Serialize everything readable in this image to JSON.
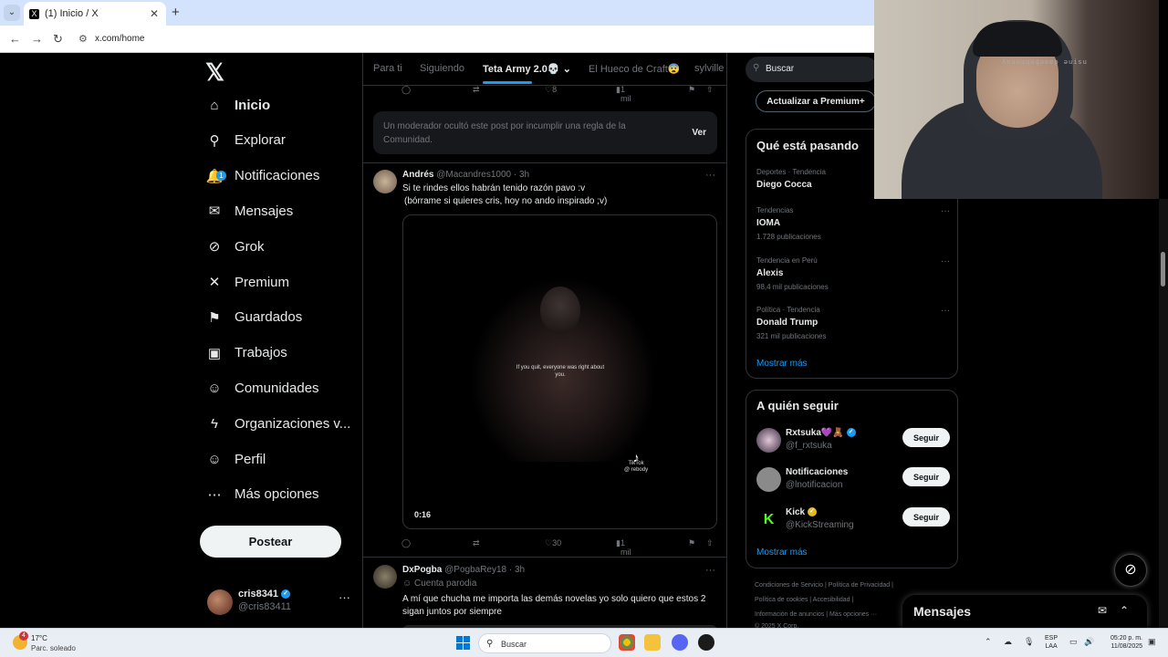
{
  "browser": {
    "tab_title": "(1) Inicio / X",
    "tab_close": "✕",
    "new_tab": "+",
    "url": "x.com/home"
  },
  "nav": {
    "logo": "𝕏",
    "items": [
      {
        "label": "Inicio",
        "icon": "home-icon"
      },
      {
        "label": "Explorar",
        "icon": "search-icon"
      },
      {
        "label": "Notificaciones",
        "icon": "bell-icon",
        "badge": "1"
      },
      {
        "label": "Mensajes",
        "icon": "mail-icon"
      },
      {
        "label": "Grok",
        "icon": "grok-icon"
      },
      {
        "label": "Premium",
        "icon": "x-icon"
      },
      {
        "label": "Guardados",
        "icon": "bookmark-icon"
      },
      {
        "label": "Trabajos",
        "icon": "briefcase-icon"
      },
      {
        "label": "Comunidades",
        "icon": "people-icon"
      },
      {
        "label": "Organizaciones v...",
        "icon": "lightning-icon"
      },
      {
        "label": "Perfil",
        "icon": "person-icon"
      },
      {
        "label": "Más opciones",
        "icon": "more-circle-icon"
      }
    ],
    "post_button": "Postear",
    "account": {
      "name": "cris8341",
      "handle": "@cris83411",
      "more": "···"
    }
  },
  "timeline": {
    "tabs": [
      "Para ti",
      "Siguiendo",
      "Teta Army 2.0💀",
      "El Hueco de Craft😨",
      "sylville"
    ],
    "active_tab": 2,
    "top_actions": {
      "likes": "8",
      "views": "1 mil"
    },
    "hidden_post": {
      "text": "Un moderador ocultó este post por incumplir una regla de la Comunidad.",
      "button": "Ver"
    },
    "post1": {
      "name": "Andrés",
      "handle": "@Macandres1000 · 3h",
      "text1": "Si te rindes ellos habrán tenido razón pavo :v",
      "text2": "(bórrame si quieres cris, hoy no ando inspirado ;v)",
      "video_caption": "If you quit, everyone was right about you.",
      "tiktok_label": "TikTok",
      "tiktok_user": "@ rebody",
      "video_time": "0:16",
      "likes": "30",
      "views": "1 mil"
    },
    "post2": {
      "name": "DxPogba",
      "handle": "@PogbaRey18 · 3h",
      "parody": "Cuenta parodia",
      "text": "A mí que chucha me importa las demás novelas yo solo quiero que estos 2 sigan juntos por siempre"
    }
  },
  "right": {
    "search_placeholder": "Buscar",
    "premium_button": "Actualizar a Premium+",
    "trends_title": "Qué está pasando",
    "trends": [
      {
        "context": "Deportes · Tendencia",
        "name": "Diego Cocca",
        "posts": ""
      },
      {
        "context": "Tendencias",
        "name": "IOMA",
        "posts": "1.728 publicaciones"
      },
      {
        "context": "Tendencia en Perú",
        "name": "Alexis",
        "posts": "98,4 mil publicaciones"
      },
      {
        "context": "Política · Tendencia",
        "name": "Donald Trump",
        "posts": "321 mil publicaciones"
      }
    ],
    "show_more": "Mostrar más",
    "follow_title": "A quién seguir",
    "follow": [
      {
        "name": "Rxtsuka💜🧸",
        "handle": "@f_rxtsuka",
        "button": "Seguir"
      },
      {
        "name": "Notificaciones",
        "handle": "@lnotificacion",
        "button": "Seguir"
      },
      {
        "name": "Kick",
        "handle": "@KickStreaming",
        "button": "Seguir"
      }
    ],
    "follow_more": "Mostrar más",
    "footer1": "Condiciones de Servicio  |  Política de Privacidad  |",
    "footer2": "Política de cookies  |  Accesibilidad  |",
    "footer3": "Información de anuncios  |  Más opciones ···",
    "footer4": "© 2025 X Corp."
  },
  "messages": {
    "title": "Mensajes"
  },
  "webcam": {
    "overlay": "ʎsuuəqoqǝoɐp ǝuisu"
  },
  "taskbar": {
    "weather_temp": "17°C",
    "weather_desc": "Parc. soleado",
    "weather_badge": "4",
    "search": "Buscar",
    "lang1": "ESP",
    "lang2": "LAA",
    "time": "05:20 p. m.",
    "date": "11/08/2025"
  }
}
